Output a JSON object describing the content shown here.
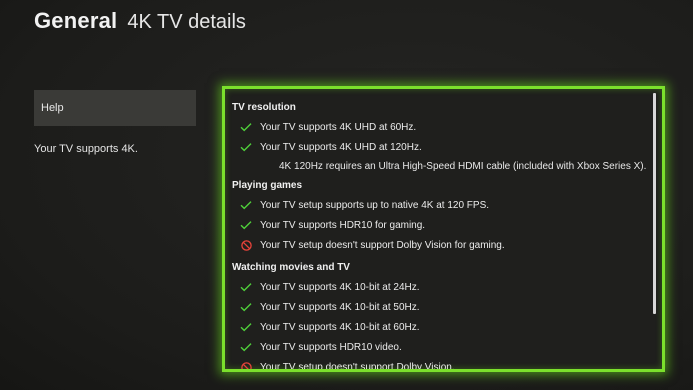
{
  "header": {
    "section": "General",
    "title": "4K TV details"
  },
  "sidebar": {
    "help_label": "Help",
    "status_text": "Your TV supports 4K."
  },
  "details": {
    "tv_resolution": {
      "heading": "TV resolution",
      "items": [
        {
          "status": "supported",
          "icon": "check-icon",
          "text": "Your TV supports 4K UHD at 60Hz."
        },
        {
          "status": "supported",
          "icon": "check-icon",
          "text": "Your TV supports 4K UHD at 120Hz."
        }
      ],
      "note": "4K 120Hz requires an Ultra High-Speed HDMI cable (included with Xbox Series X)."
    },
    "playing_games": {
      "heading": "Playing games",
      "items": [
        {
          "status": "supported",
          "icon": "check-icon",
          "text": "Your TV setup supports up to native 4K at 120 FPS."
        },
        {
          "status": "supported",
          "icon": "check-icon",
          "text": "Your TV supports HDR10 for gaming."
        },
        {
          "status": "unsupported",
          "icon": "prohibited-icon",
          "text": "Your TV setup doesn't support Dolby Vision for gaming."
        }
      ]
    },
    "watching_movies": {
      "heading": "Watching movies and TV",
      "items": [
        {
          "status": "supported",
          "icon": "check-icon",
          "text": "Your TV supports 4K 10-bit at 24Hz."
        },
        {
          "status": "supported",
          "icon": "check-icon",
          "text": "Your TV supports 4K 10-bit at 50Hz."
        },
        {
          "status": "supported",
          "icon": "check-icon",
          "text": "Your TV supports 4K 10-bit at 60Hz."
        },
        {
          "status": "supported",
          "icon": "check-icon",
          "text": "Your TV supports HDR10 video."
        },
        {
          "status": "unsupported",
          "icon": "prohibited-icon",
          "text": "Your TV setup doesn't support Dolby Vision."
        }
      ]
    }
  },
  "colors": {
    "focus_glow": "#7be02c",
    "check": "#4fcf3a",
    "prohibited": "#e8433a",
    "background": "#1d1d1b",
    "help_button_bg": "#3a3a37"
  }
}
